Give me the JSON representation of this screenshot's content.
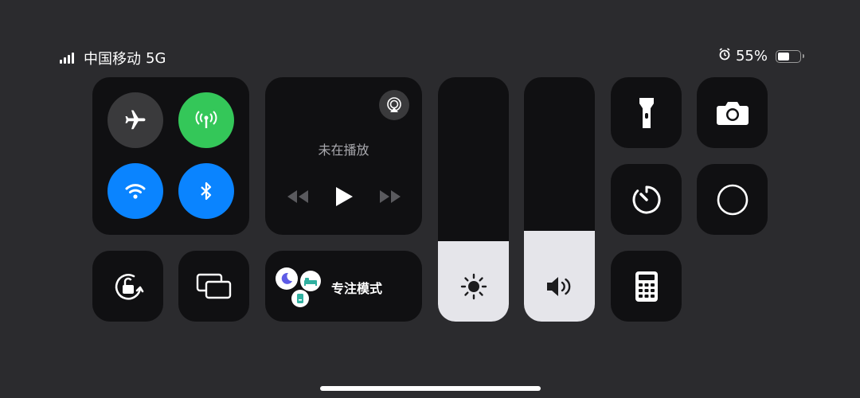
{
  "status_bar": {
    "carrier": "中国移动",
    "network": "5G",
    "battery_percent": "55%",
    "battery_level": 0.55,
    "signal_icon": "signal-bars-icon",
    "alarm_icon": "alarm-clock-icon"
  },
  "connectivity": {
    "airplane": {
      "icon": "airplane-icon",
      "on": false,
      "color": "#3a3a3c"
    },
    "cellular": {
      "icon": "cellular-antenna-icon",
      "on": true,
      "color": "#34c759"
    },
    "wifi": {
      "icon": "wifi-icon",
      "on": true,
      "color": "#0a84ff"
    },
    "bluetooth": {
      "icon": "bluetooth-icon",
      "on": true,
      "color": "#0a84ff"
    }
  },
  "media": {
    "status": "未在播放",
    "icons": [
      "airplay-icon",
      "rewind-icon",
      "play-icon",
      "fast-forward-icon"
    ]
  },
  "focus": {
    "label": "专注模式",
    "icons": [
      "moon-icon",
      "bed-icon",
      "id-badge-icon"
    ]
  },
  "sliders": {
    "brightness": {
      "icon": "sun-icon",
      "level": 0.33
    },
    "volume": {
      "icon": "speaker-icon",
      "level": 0.37
    }
  },
  "shortcuts": [
    "flashlight-icon",
    "camera-icon",
    "timer-icon",
    "screen-record-icon",
    "rotation-lock-icon",
    "screen-mirroring-icon",
    "calculator-icon"
  ]
}
